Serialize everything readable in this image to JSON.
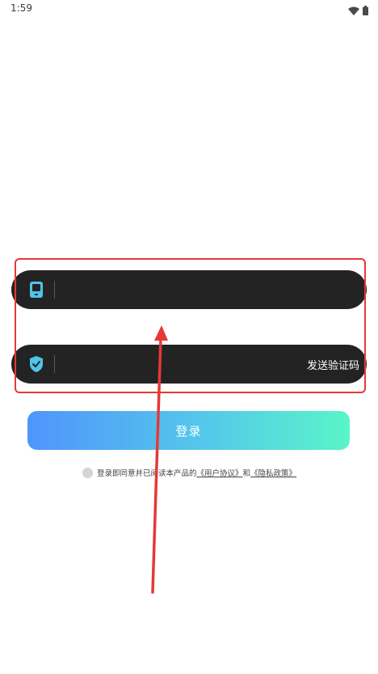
{
  "status_bar": {
    "time": "1:59",
    "icons": [
      "wifi-icon",
      "battery-icon"
    ]
  },
  "phone_field": {
    "icon": "phone-icon",
    "value": "",
    "placeholder": ""
  },
  "code_field": {
    "icon": "shield-check-icon",
    "value": "",
    "placeholder": "",
    "send_code_label": "发送验证码"
  },
  "login_button": {
    "label": "登录"
  },
  "agreement": {
    "checked": false,
    "prefix": "登录即同意并已阅读本产品的",
    "user_agreement": "《用户协议》",
    "conjunction": "和",
    "privacy_policy": "《隐私政策》"
  },
  "colors": {
    "field_background": "#232323",
    "icon_accent": "#4fc3e8",
    "annotation_red": "#e53935",
    "gradient_start": "#4f95fb",
    "gradient_end": "#59f5c8"
  }
}
